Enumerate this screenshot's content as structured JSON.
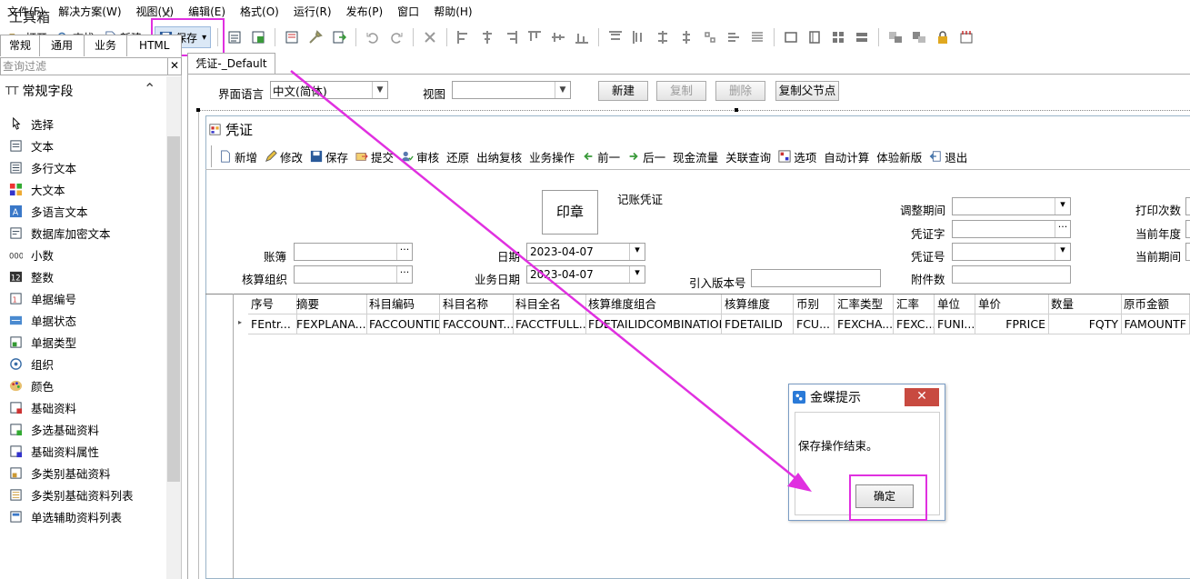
{
  "menu": [
    "文件(F)",
    "解决方案(W)",
    "视图(V)",
    "编辑(E)",
    "格式(O)",
    "运行(R)",
    "发布(P)",
    "窗口",
    "帮助(H)"
  ],
  "toolbar": {
    "open": "打开",
    "find": "查找",
    "new": "新建",
    "save": "保存",
    "save_arrow": "▾"
  },
  "toolbox": {
    "title": "工具箱",
    "pin": "ᵖ",
    "close": "✕",
    "tabs": [
      "常规",
      "通用",
      "业务",
      "HTML"
    ],
    "filter_placeholder": "查询过滤",
    "filter_clear": "✕",
    "group": "常规字段",
    "group_prefix": "TT",
    "group_caret": "⌃",
    "items": [
      "选择",
      "文本",
      "多行文本",
      "大文本",
      "多语言文本",
      "数据库加密文本",
      "小数",
      "整数",
      "单据编号",
      "单据状态",
      "单据类型",
      "组织",
      "颜色",
      "基础资料",
      "多选基础资料",
      "基础资料属性",
      "多类别基础资料",
      "多类别基础资料列表",
      "单选辅助资料列表"
    ]
  },
  "doc_tab": "凭证-_Default",
  "props": {
    "lang_label": "界面语言",
    "lang_value": "中文(简体)",
    "view_label": "视图",
    "view_value": "",
    "btn_new": "新建",
    "btn_copy": "复制",
    "btn_delete": "删除",
    "btn_copy_parent": "复制父节点"
  },
  "form": {
    "title": "凭证",
    "tools": [
      "新增",
      "修改",
      "保存",
      "提交",
      "审核",
      "还原",
      "出纳复核",
      "业务操作",
      "前一",
      "后一",
      "现金流量",
      "关联查询",
      "选项",
      "自动计算",
      "体验新版",
      "退出"
    ],
    "seal": "印章",
    "voucher_title": "记账凭证",
    "ledger_label": "账簿",
    "org_label": "核算组织",
    "date_label": "日期",
    "date_value": "2023-04-07",
    "bizdate_label": "业务日期",
    "bizdate_value": "2023-04-07",
    "version_label": "引入版本号",
    "adjust_label": "调整期间",
    "word_label": "凭证字",
    "number_label": "凭证号",
    "attach_label": "附件数",
    "print_label": "打印次数",
    "year_label": "当前年度",
    "period_label": "当前期间"
  },
  "grid": {
    "headers": [
      "序号",
      "摘要",
      "科目编码",
      "科目名称",
      "科目全名",
      "核算维度组合",
      "核算维度",
      "币别",
      "汇率类型",
      "汇率",
      "单位",
      "单价",
      "数量",
      "原币金额"
    ],
    "row": [
      "FEntr...",
      "FEXPLANA...",
      "FACCOUNTID",
      "FACCOUNT...",
      "FACCTFULL...",
      "FDETAILIDCOMBINATION",
      "FDETAILID",
      "FCU...",
      "FEXCHA...",
      "FEXC...",
      "FUNI...",
      "FPRICE",
      "FQTY",
      "FAMOUNTF"
    ]
  },
  "dialog": {
    "title": "金蝶提示",
    "close": "✕",
    "message": "保存操作结束。",
    "ok": "确定"
  },
  "colors": {
    "highlight": "#e030e0",
    "close_red": "#c84a40"
  }
}
